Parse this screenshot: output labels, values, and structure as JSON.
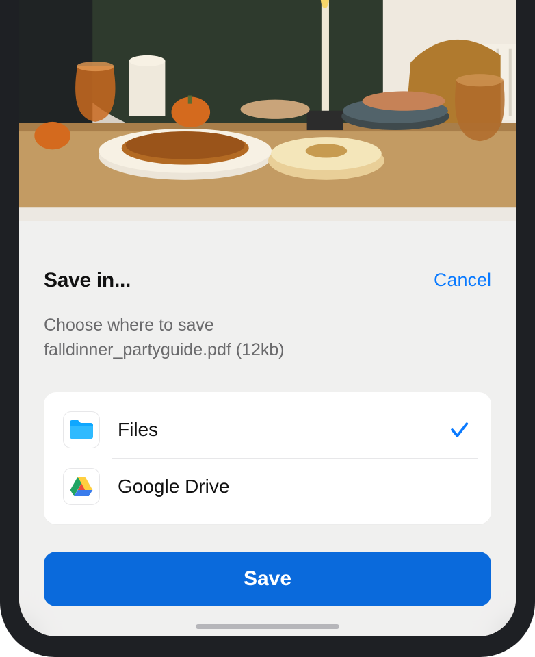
{
  "sheet": {
    "title": "Save in...",
    "cancel": "Cancel",
    "subtitle_line1": "Choose where to save",
    "subtitle_line2": "falldinner_partyguide.pdf (12kb)",
    "options": [
      {
        "label": "Files",
        "selected": true
      },
      {
        "label": "Google Drive",
        "selected": false
      }
    ],
    "save_button": "Save"
  }
}
